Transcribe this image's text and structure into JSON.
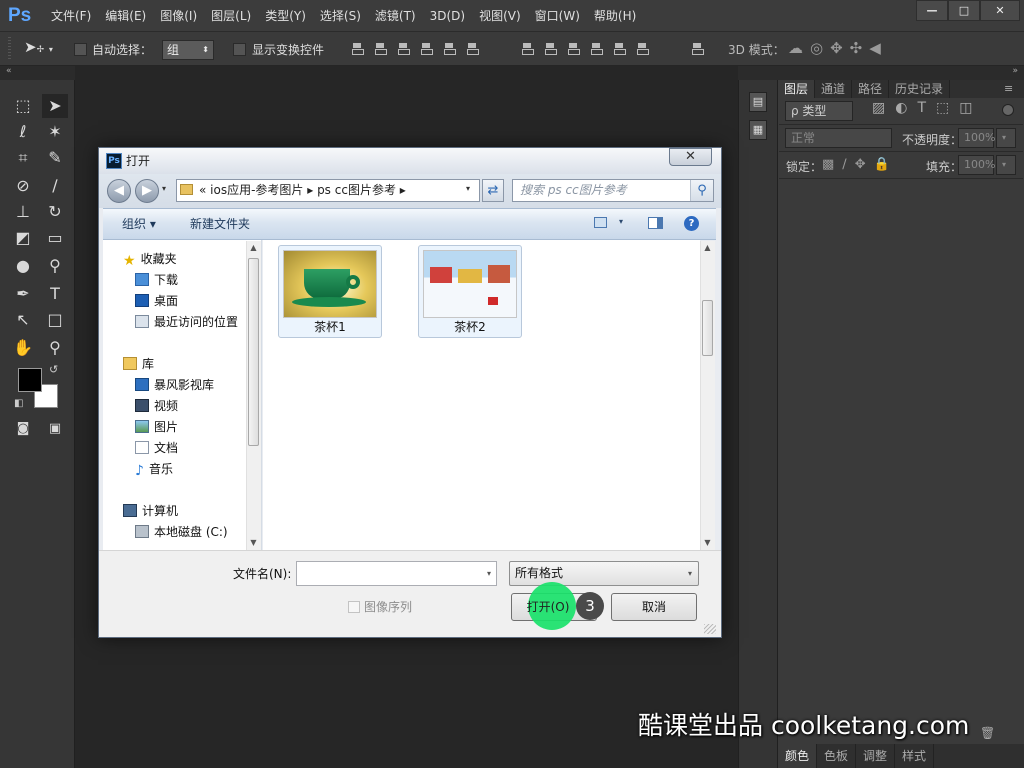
{
  "app": {
    "logo": "Ps"
  },
  "menu": [
    "文件(F)",
    "编辑(E)",
    "图像(I)",
    "图层(L)",
    "类型(Y)",
    "选择(S)",
    "滤镜(T)",
    "3D(D)",
    "视图(V)",
    "窗口(W)",
    "帮助(H)"
  ],
  "options": {
    "auto_select_label": "自动选择：",
    "auto_select_value": "组",
    "show_transform_label": "显示变换控件",
    "mode_3d_label": "3D 模式："
  },
  "layers_panel": {
    "tabs": [
      "图层",
      "通道",
      "路径",
      "历史记录"
    ],
    "kind_filter": "ρ 类型",
    "blend_mode": "正常",
    "opacity_label": "不透明度：",
    "opacity_value": "100%",
    "lock_label": "锁定：",
    "fill_label": "填充：",
    "fill_value": "100%"
  },
  "bottom_tabs": [
    "颜色",
    "色板",
    "调整",
    "样式"
  ],
  "dialog": {
    "title": "打开",
    "address": "«  ios应用-参考图片  ▸  ps cc图片参考  ▸",
    "search_placeholder": "搜索 ps cc图片参考",
    "organize": "组织 ▾",
    "new_folder": "新建文件夹",
    "nav_items": [
      {
        "label": "收藏夹"
      },
      {
        "label": "下载"
      },
      {
        "label": "桌面"
      },
      {
        "label": "最近访问的位置"
      },
      {
        "label": "库"
      },
      {
        "label": "暴风影视库"
      },
      {
        "label": "视频"
      },
      {
        "label": "图片"
      },
      {
        "label": "文档"
      },
      {
        "label": "音乐"
      },
      {
        "label": "计算机"
      },
      {
        "label": "本地磁盘 (C:)"
      }
    ],
    "files": [
      {
        "name": "茶杯1"
      },
      {
        "name": "茶杯2"
      }
    ],
    "filename_label": "文件名(N):",
    "filename_value": "",
    "filter_value": "所有格式",
    "image_sequence_label": "图像序列",
    "open_button": "打开(O)",
    "cancel_button": "取消"
  },
  "overlay": {
    "step_number": "3",
    "watermark": "酷课堂出品 coolketang.com"
  }
}
